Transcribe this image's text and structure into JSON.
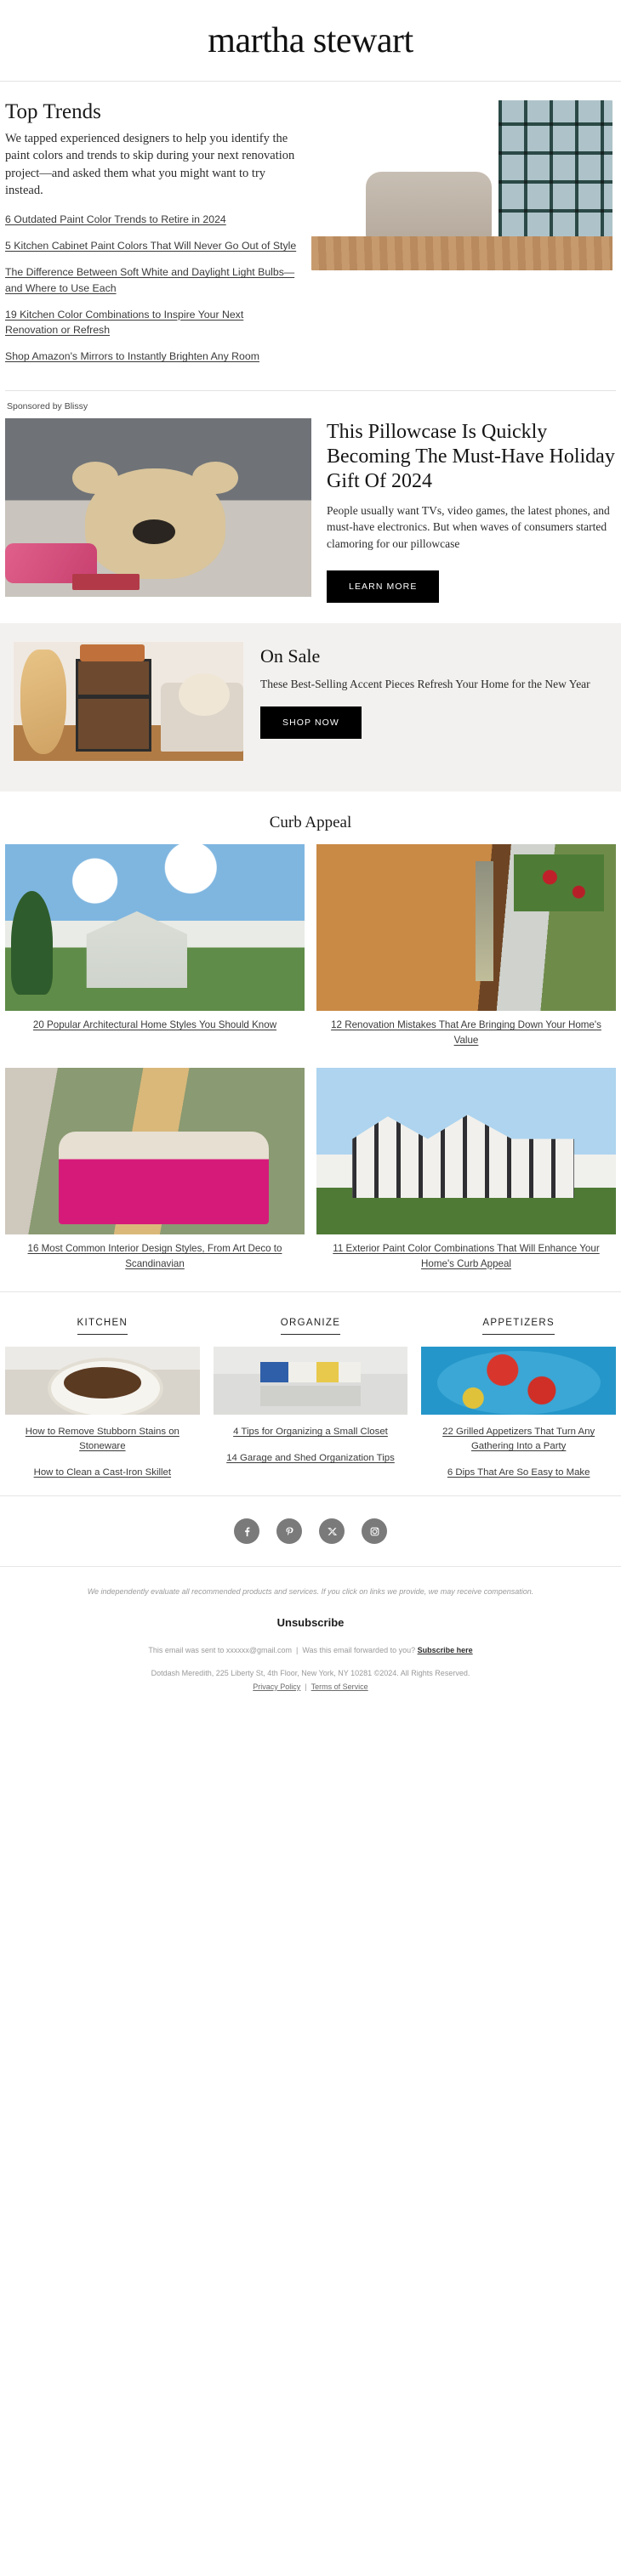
{
  "masthead": {
    "brand": "martha stewart"
  },
  "top_trends": {
    "title": "Top Trends",
    "dek": "We tapped experienced designers to help you identify the paint colors and trends to skip during your next renovation project—and asked them what you might want to try instead.",
    "links": [
      "6 Outdated Paint Color Trends to Retire in 2024",
      "5 Kitchen Cabinet Paint Colors That Will Never Go Out of Style",
      "The Difference Between Soft White and Daylight Light Bulbs—and Where to Use Each",
      "19 Kitchen Color Combinations to Inspire Your Next Renovation or Refresh",
      "Shop Amazon's Mirrors to Instantly Brighten Any Room"
    ],
    "image_name": "floral-wallpaper-room-photo"
  },
  "sponsored": {
    "kicker": "Sponsored by Blissy",
    "headline": "This Pillowcase Is Quickly Becoming The Must-Have Holiday Gift Of 2024",
    "body": "People usually want TVs, video games, the latest phones, and must-have electronics. But when waves of consumers started clamoring for our pillowcase",
    "cta": "LEARN MORE",
    "image_name": "giant-teddy-bear-photo"
  },
  "on_sale": {
    "title": "On Sale",
    "subtitle": "These Best-Selling Accent Pieces Refresh Your Home for the New Year",
    "cta": "SHOP NOW",
    "image_name": "record-player-shelf-photo"
  },
  "curb_appeal": {
    "title": "Curb Appeal",
    "cards": [
      {
        "caption": "20 Popular Architectural Home Styles You Should Know",
        "image_name": "farmhouse-exterior-photo"
      },
      {
        "caption": "12 Renovation Mistakes That Are Bringing Down Your Home's Value",
        "image_name": "wooden-front-door-photo"
      },
      {
        "caption": "16 Most Common Interior Design Styles, From Art Deco to Scandinavian",
        "image_name": "pink-velvet-sofa-photo"
      },
      {
        "caption": "11 Exterior Paint Color Combinations That Will Enhance Your Home's Curb Appeal",
        "image_name": "tudor-style-house-photo"
      }
    ]
  },
  "categories": [
    {
      "heading": "KITCHEN",
      "image_name": "dutch-oven-photo",
      "links": [
        "How to Remove Stubborn Stains on Stoneware",
        "How to Clean a Cast-Iron Skillet"
      ]
    },
    {
      "heading": "ORGANIZE",
      "image_name": "organized-closet-photo",
      "links": [
        "4 Tips for Organizing a Small Closet",
        "14 Garage and Shed Organization Tips"
      ]
    },
    {
      "heading": "APPETIZERS",
      "image_name": "grilled-tomato-appetizer-photo",
      "links": [
        "22 Grilled Appetizers That Turn Any Gathering Into a Party",
        "6 Dips That Are So Easy to Make"
      ]
    }
  ],
  "social": [
    {
      "name": "facebook-icon"
    },
    {
      "name": "pinterest-icon"
    },
    {
      "name": "x-twitter-icon"
    },
    {
      "name": "instagram-icon"
    }
  ],
  "footer": {
    "disclaimer": "We independently evaluate all recommended products and services. If you click on links we provide, we may receive compensation.",
    "unsubscribe": "Unsubscribe",
    "sent_to": "This email was sent to xxxxxx@gmail.com",
    "forwarded": "Was this email forwarded to you?",
    "subscribe_here": "Subscribe here",
    "address": "Dotdash Meredith, 225 Liberty St, 4th Floor, New York, NY 10281 ©2024. All Rights Reserved.",
    "privacy_policy": "Privacy Policy",
    "terms_of_service": "Terms of Service",
    "separator": "|"
  },
  "colors": {
    "accent_dark": "#000000",
    "bg_sale": "#f3f1ef",
    "social_gray": "#7a7a7a"
  }
}
